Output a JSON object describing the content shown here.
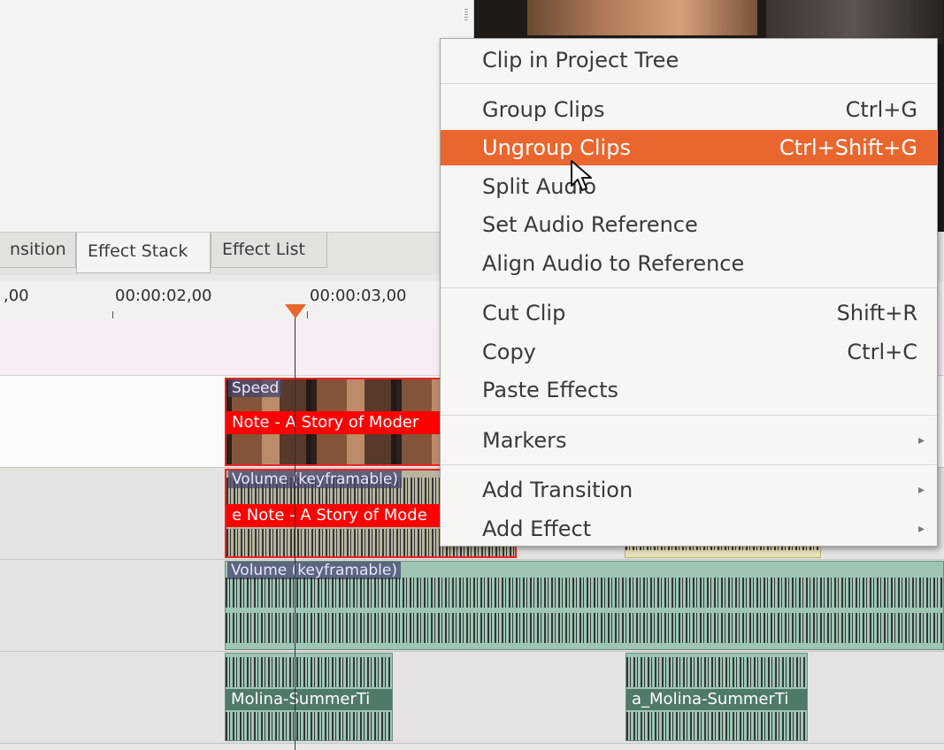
{
  "tabs": [
    {
      "label": "nsition"
    },
    {
      "label": "Effect Stack"
    },
    {
      "label": "Effect List"
    }
  ],
  "ruler": {
    "labels": [
      ",00",
      "00:00:02,00",
      "00:00:03,00"
    ]
  },
  "clips": {
    "video_effect": "Speed",
    "video_name": "Note - A Story of Moder",
    "audio1_effect": "Volume (keyframable)",
    "audio1_name": "e Note - A Story of Mode",
    "audio2_effect": "Volume (keyframable)",
    "music_left_name": "Molina-SummerTi",
    "music_right_name": "a_Molina-SummerTi"
  },
  "menu": {
    "items": [
      {
        "label": "Clip in Project Tree",
        "shortcut": ""
      },
      {
        "label": "Group Clips",
        "shortcut": "Ctrl+G"
      },
      {
        "label": "Ungroup Clips",
        "shortcut": "Ctrl+Shift+G"
      },
      {
        "label": "Split Audio",
        "shortcut": ""
      },
      {
        "label": "Set Audio Reference",
        "shortcut": ""
      },
      {
        "label": "Align Audio to Reference",
        "shortcut": ""
      },
      {
        "label": "Cut Clip",
        "shortcut": "Shift+R"
      },
      {
        "label": "Copy",
        "shortcut": "Ctrl+C"
      },
      {
        "label": "Paste Effects",
        "shortcut": ""
      },
      {
        "label": "Markers",
        "shortcut": ""
      },
      {
        "label": "Add Transition",
        "shortcut": ""
      },
      {
        "label": "Add Effect",
        "shortcut": ""
      }
    ],
    "highlight_color": "#e9662e",
    "submenu_arrow": "▸"
  },
  "colors": {
    "selected_clip_border": "#ee2222",
    "audio_clip": "#9fc6b4",
    "playhead": "#e8672c"
  }
}
